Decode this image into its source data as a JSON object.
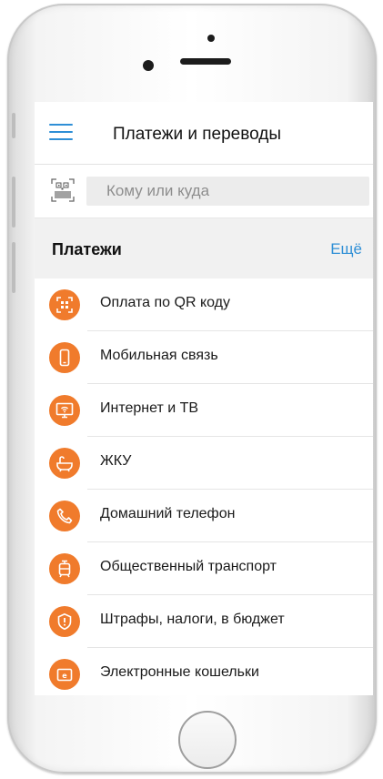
{
  "header": {
    "title": "Платежи и переводы"
  },
  "search": {
    "placeholder": "Кому или куда"
  },
  "section": {
    "title": "Платежи",
    "more_label": "Ещё"
  },
  "payments": [
    {
      "label": "Оплата по QR коду",
      "icon": "qr-code-icon"
    },
    {
      "label": "Мобильная связь",
      "icon": "mobile-phone-icon"
    },
    {
      "label": "Интернет и ТВ",
      "icon": "tv-wifi-icon"
    },
    {
      "label": "ЖКУ",
      "icon": "bathtub-icon"
    },
    {
      "label": "Домашний телефон",
      "icon": "phone-handset-icon"
    },
    {
      "label": "Общественный транспорт",
      "icon": "tram-icon"
    },
    {
      "label": "Штрафы, налоги, в бюджет",
      "icon": "alert-shield-icon"
    },
    {
      "label": "Электронные кошельки",
      "icon": "wallet-icon"
    }
  ],
  "colors": {
    "accent": "#2f8fd6",
    "icon_bg": "#f07b2c",
    "screen_bg": "#f1f1f1"
  }
}
